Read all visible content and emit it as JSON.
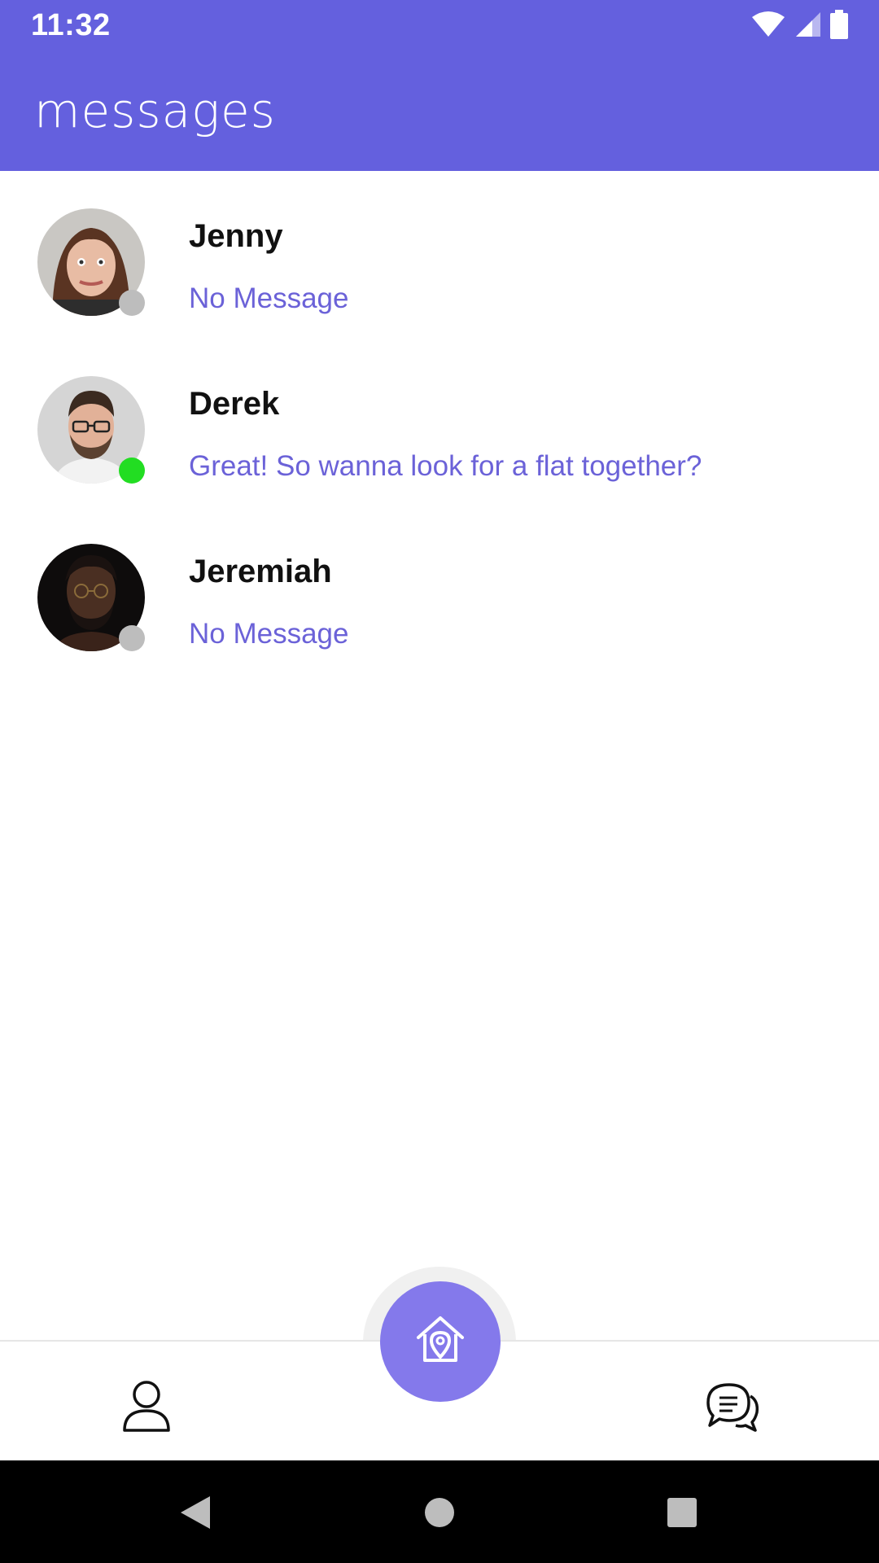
{
  "status_bar": {
    "time": "11:32",
    "icons": [
      "wifi-icon",
      "signal-icon",
      "battery-icon"
    ]
  },
  "header": {
    "title": "messages"
  },
  "conversations": [
    {
      "name": "Jenny",
      "last_message": "No Message",
      "online": false
    },
    {
      "name": "Derek",
      "last_message": "Great! So wanna look for a flat together?",
      "online": true
    },
    {
      "name": "Jeremiah",
      "last_message": "No Message",
      "online": false
    }
  ],
  "bottom_nav": {
    "items": [
      "profile-icon",
      "home-location-icon",
      "chat-icon"
    ]
  },
  "system_nav": {
    "items": [
      "back-icon",
      "home-icon",
      "recents-icon"
    ]
  },
  "colors": {
    "primary": "#6460DE",
    "accent_text": "#6B62D8",
    "fab": "#8479EB",
    "online": "#22DD22",
    "offline": "#BDBDBD"
  }
}
